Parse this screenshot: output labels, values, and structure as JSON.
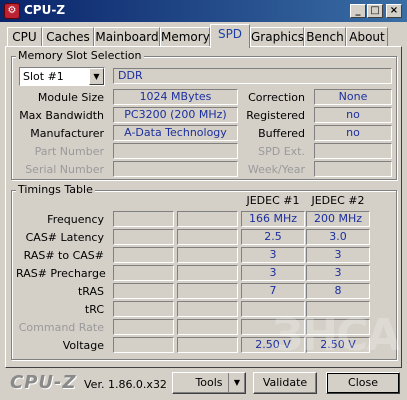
{
  "window": {
    "title": "CPU-Z",
    "icon": "cpuz-app-icon",
    "controls": {
      "minimize": "_",
      "maximize": "□",
      "close": "×"
    }
  },
  "tabs": [
    {
      "label": "CPU",
      "active": false
    },
    {
      "label": "Caches",
      "active": false
    },
    {
      "label": "Mainboard",
      "active": false
    },
    {
      "label": "Memory",
      "active": false
    },
    {
      "label": "SPD",
      "active": true
    },
    {
      "label": "Graphics",
      "active": false
    },
    {
      "label": "Bench",
      "active": false
    },
    {
      "label": "About",
      "active": false
    }
  ],
  "memory_slot": {
    "group_title": "Memory Slot Selection",
    "slot_selected": "Slot #1",
    "type": "DDR",
    "module_size_label": "Module Size",
    "module_size": "1024 MBytes",
    "max_bandwidth_label": "Max Bandwidth",
    "max_bandwidth": "PC3200 (200 MHz)",
    "manufacturer_label": "Manufacturer",
    "manufacturer": "A-Data Technology",
    "part_number_label": "Part Number",
    "part_number": "",
    "serial_number_label": "Serial Number",
    "serial_number": "",
    "correction_label": "Correction",
    "correction": "None",
    "registered_label": "Registered",
    "registered": "no",
    "buffered_label": "Buffered",
    "buffered": "no",
    "spd_ext_label": "SPD Ext.",
    "spd_ext": "",
    "week_year_label": "Week/Year",
    "week_year": ""
  },
  "timings": {
    "group_title": "Timings Table",
    "col_headers": [
      "",
      "",
      "JEDEC #1",
      "JEDEC #2"
    ],
    "rows": [
      {
        "label": "Frequency",
        "dim": false,
        "values": [
          "",
          "",
          "166 MHz",
          "200 MHz"
        ]
      },
      {
        "label": "CAS# Latency",
        "dim": false,
        "values": [
          "",
          "",
          "2.5",
          "3.0"
        ]
      },
      {
        "label": "RAS# to CAS#",
        "dim": false,
        "values": [
          "",
          "",
          "3",
          "3"
        ]
      },
      {
        "label": "RAS# Precharge",
        "dim": false,
        "values": [
          "",
          "",
          "3",
          "3"
        ]
      },
      {
        "label": "tRAS",
        "dim": false,
        "values": [
          "",
          "",
          "7",
          "8"
        ]
      },
      {
        "label": "tRC",
        "dim": false,
        "values": [
          "",
          "",
          "",
          ""
        ]
      },
      {
        "label": "Command Rate",
        "dim": true,
        "values": [
          "",
          "",
          "",
          ""
        ]
      },
      {
        "label": "Voltage",
        "dim": false,
        "values": [
          "",
          "",
          "2.50 V",
          "2.50 V"
        ]
      }
    ]
  },
  "footer": {
    "logo": "CPU-Z",
    "version": "Ver. 1.86.0.x32",
    "tools_label": "Tools",
    "validate_label": "Validate",
    "close_label": "Close"
  },
  "watermark": "ЗНСА"
}
